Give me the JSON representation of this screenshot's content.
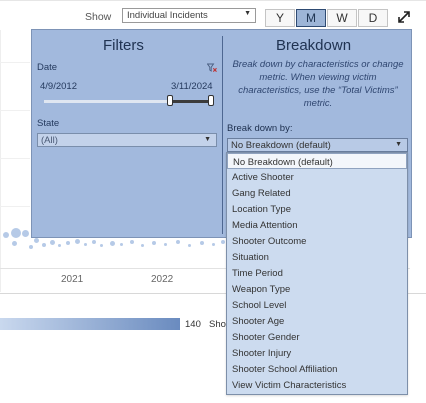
{
  "toolbar": {
    "show_label": "Show",
    "show_value": "Individual Incidents",
    "period_buttons": [
      "Y",
      "M",
      "W",
      "D"
    ],
    "active_period": "M",
    "expand_icon": "expand-icon"
  },
  "chart": {
    "x_ticks": [
      "2021",
      "2022"
    ],
    "legend_max": "140",
    "legend_partial": "Sho"
  },
  "filters": {
    "title": "Filters",
    "date_label": "Date",
    "date_start": "4/9/2012",
    "date_end": "3/11/2024",
    "state_label": "State",
    "state_value": "(All)",
    "clear_icon": "filter-clear-icon"
  },
  "breakdown": {
    "title": "Breakdown",
    "description": "Break down by characteristics or change metric. When viewing victim characteristics, use the “Total Victims” metric.",
    "label": "Break down by:",
    "selected": "No Breakdown (default)",
    "options": [
      "No Breakdown (default)",
      "Active Shooter",
      "Gang Related",
      "Location Type",
      "Media Attention",
      "Shooter Outcome",
      "Situation",
      "Time Period",
      "Weapon Type",
      "School Level",
      "Shooter Age",
      "Shooter Gender",
      "Shooter Injury",
      "Shooter School Affiliation",
      "View Victim Characteristics"
    ]
  },
  "colors": {
    "popup_bg": "#a2b9dd",
    "dropdown_bg": "#ccdbef",
    "accent": "#2e4a72",
    "dot": "#a9c1e3"
  }
}
